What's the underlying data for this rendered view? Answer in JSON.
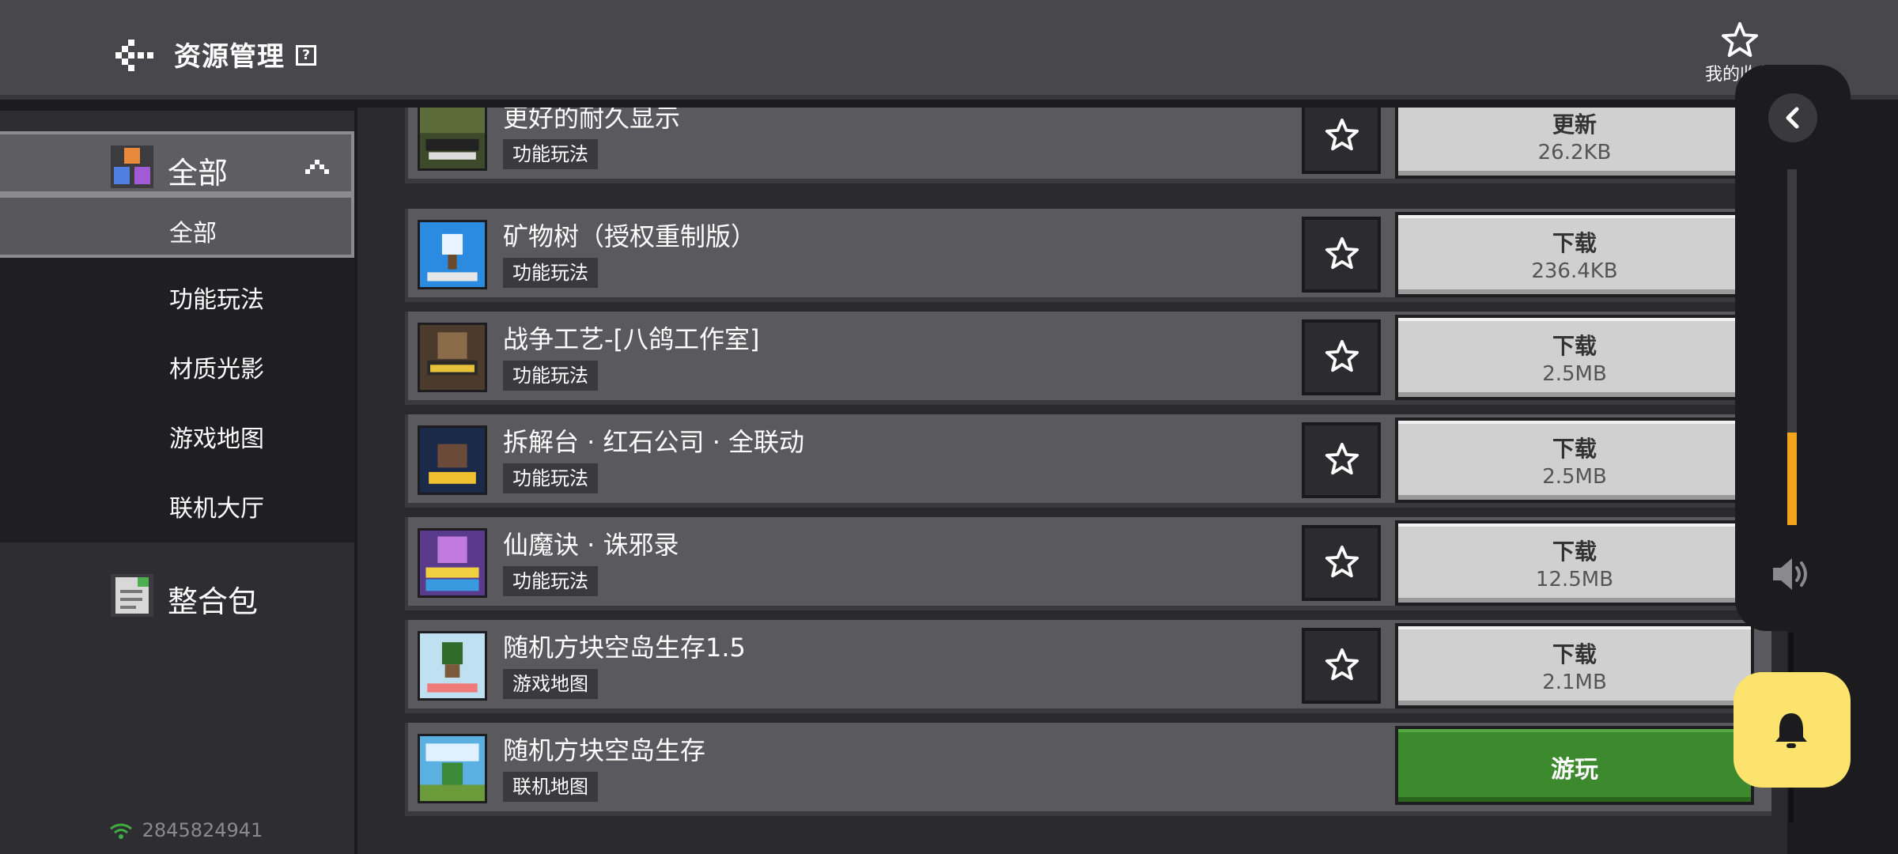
{
  "header": {
    "title": "资源管理",
    "help_symbol": "?",
    "favorites_label": "我的收藏"
  },
  "sidebar": {
    "categories": [
      {
        "label": "全部",
        "icon": "all-resources-icon",
        "expanded": true
      },
      {
        "label": "整合包",
        "icon": "modpack-icon"
      }
    ],
    "sub_items": [
      {
        "label": "全部",
        "active": true
      },
      {
        "label": "功能玩法"
      },
      {
        "label": "材质光影"
      },
      {
        "label": "游戏地图"
      },
      {
        "label": "联机大厅"
      }
    ],
    "network_id": "2845824941"
  },
  "list": {
    "items": [
      {
        "name": "更好的耐久显示",
        "tag": "功能玩法",
        "action": "更新",
        "size": "26.2KB"
      },
      {
        "name": "矿物树（授权重制版）",
        "tag": "功能玩法",
        "action": "下载",
        "size": "236.4KB"
      },
      {
        "name": "战争工艺-[八鸽工作室]",
        "tag": "功能玩法",
        "action": "下载",
        "size": "2.5MB"
      },
      {
        "name": "拆解台 · 红石公司 · 全联动",
        "tag": "功能玩法",
        "action": "下载",
        "size": "2.5MB"
      },
      {
        "name": "仙魔诀 · 诛邪录",
        "tag": "功能玩法",
        "action": "下载",
        "size": "12.5MB"
      },
      {
        "name": "随机方块空岛生存1.5",
        "tag": "游戏地图",
        "action": "下载",
        "size": "2.1MB"
      },
      {
        "name": "随机方块空岛生存",
        "tag": "联机地图",
        "action": "游玩"
      }
    ]
  },
  "float_panel": {
    "volume_level": 0.26
  },
  "colors": {
    "accent_orange": "#f2a51c",
    "play_green": "#3d8a2e",
    "bell_yellow": "#fbe36e"
  }
}
